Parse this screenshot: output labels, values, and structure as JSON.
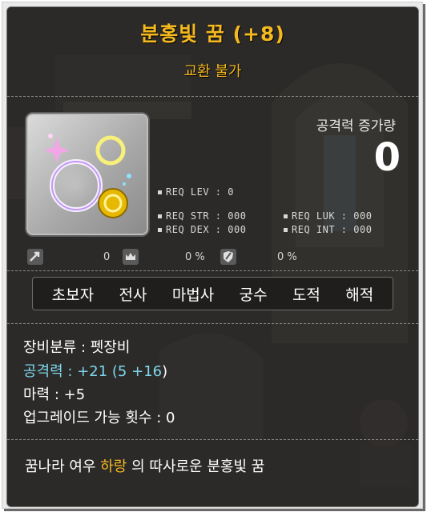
{
  "item": {
    "name": "분홍빛 꿈 (+8)",
    "trade_status": "교환 불가"
  },
  "attack_increase": {
    "label": "공격력 증가량",
    "value": "0"
  },
  "requirements": {
    "lev": "REQ LEV :    0",
    "str": "REQ STR : 000",
    "dex": "REQ DEX : 000",
    "luk": "REQ LUK : 000",
    "int": "REQ INT : 000"
  },
  "extra_stats": {
    "first_value": "0",
    "second_value": "0 %",
    "third_value": "0 %"
  },
  "jobs": [
    "초보자",
    "전사",
    "마법사",
    "궁수",
    "도적",
    "해적"
  ],
  "details": {
    "category": "장비분류 : 펫장비",
    "attack_label": "공격력 :",
    "attack_value": "+21 (5 ",
    "attack_bonus": "+16",
    "attack_close": ")",
    "magic": "마력 : +5",
    "upgrades": "업그레이드 가능 횟수 : 0"
  },
  "description": {
    "prefix": "꿈나라 여우 ",
    "highlight": "하랑",
    "suffix": " 의 따사로운 분홍빛 꿈"
  },
  "colors": {
    "title": "#f5b91f",
    "stat_highlight": "#7fd6ea",
    "background": "#2a2928"
  }
}
